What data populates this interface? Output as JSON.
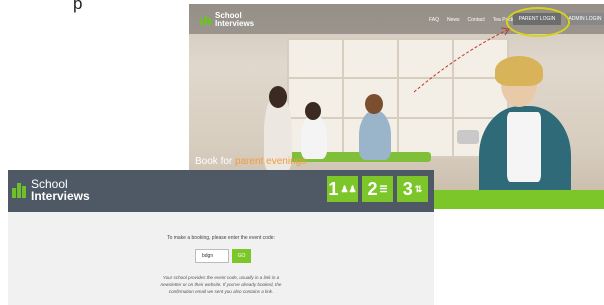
{
  "top_clipped_text": "p",
  "hero": {
    "logo": {
      "line1": "School",
      "line2": "Interviews"
    },
    "menu": [
      "FAQ",
      "News",
      "Contact",
      "Tea Pack"
    ],
    "parent_login_label": "PARENT LOGIN",
    "admin_login_label": "ADMIN LOGIN",
    "tagline_prefix": "Book for ",
    "tagline_accent": "parent evenings",
    "colors": {
      "accent": "#7cc62a",
      "highlight": "#d7d21a",
      "annotation_arrow": "#c0392b"
    }
  },
  "booking": {
    "logo": {
      "line1": "School",
      "line2": "Interviews"
    },
    "steps": [
      {
        "number": "1",
        "icon": "people-icon"
      },
      {
        "number": "2",
        "icon": "list-icon"
      },
      {
        "number": "3",
        "icon": "sort-icon"
      }
    ],
    "prompt": "To make a booking, please enter the event code:",
    "event_code_value": "bdgn",
    "go_label": "GO",
    "note_line1": "Your school provides the event code, usually in a link in a",
    "note_line2": "newsletter or on their website. If you've already booked, the",
    "note_line3": "confirmation email we sent you also contains a link.",
    "colors": {
      "header": "#4f5966",
      "accent": "#7cc62a"
    }
  }
}
